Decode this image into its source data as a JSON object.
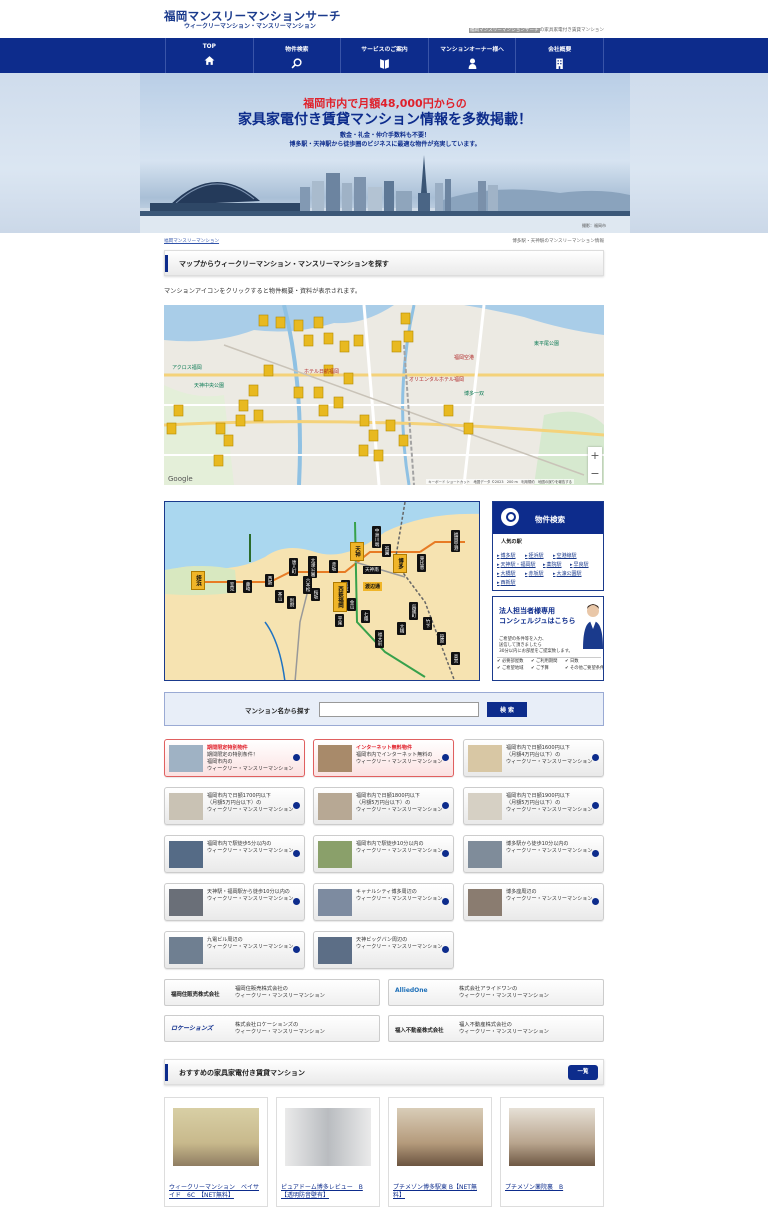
{
  "header": {
    "logo": "福岡マンスリーマンションサーチ",
    "sublogo": "ウィークリーマンション・マンスリーマンション",
    "tagline_hl": "福岡マンスリーマンションサーチ",
    "tagline_rest": "の家具家電付き賃貸マンション"
  },
  "nav": [
    {
      "label": "TOP",
      "icon": "home-icon"
    },
    {
      "label": "物件検索",
      "icon": "search-icon"
    },
    {
      "label": "サービスのご案内",
      "icon": "book-icon"
    },
    {
      "label": "マンションオーナー様へ",
      "icon": "person-icon"
    },
    {
      "label": "会社概要",
      "icon": "building-icon"
    }
  ],
  "hero": {
    "line1": "福岡市内で月額48,000円からの",
    "line2": "家具家電付き賃貸マンション情報を多数掲載！",
    "line3": "敷金・礼金・仲介手数料も不要！",
    "line4": "博多駅・天神駅から徒歩圏のビジネスに最適な物件が充実しています。",
    "caption": "撮影：福岡市"
  },
  "breadcrumb": {
    "left": "福岡マンスリーマンション",
    "right": "博多駅・天神駅のマンスリーマンション情報"
  },
  "map_section": {
    "title": "マップからウィークリーマンション・マンスリーマンションを探す",
    "note": "マンションアイコンをクリックすると物件概要・資料が表示されます。",
    "google": "Google",
    "attribution": "キーボード ショートカット　地図データ ©2023　200 m　利用規約　地図の誤りを報告する",
    "zoom_in": "+",
    "zoom_out": "−"
  },
  "route": {
    "stations": [
      "姪浜",
      "室見",
      "藤崎",
      "西新",
      "唐人町",
      "大濠公園",
      "赤坂",
      "天神",
      "中洲川端",
      "祇園",
      "博多",
      "東比恵",
      "福岡空港",
      "天神南",
      "渡辺通",
      "薬院",
      "桜坂",
      "六本松",
      "別府",
      "茶山",
      "金山",
      "七隈",
      "福大前",
      "呉服町",
      "竹下",
      "笹原",
      "大橋",
      "高宮",
      "平尾",
      "西鉄福岡",
      "天神",
      "福岡"
    ]
  },
  "search_box": {
    "title": "物件検索",
    "popular": "人気の駅",
    "stations": [
      "博多駅",
      "姪浜駅",
      "空港線駅",
      "天神駅・福岡駅",
      "薬院駅",
      "早良駅",
      "大橋駅",
      "赤坂駅",
      "大濠公園駅",
      "西新駅"
    ]
  },
  "concierge": {
    "line1": "法人担当者様専用",
    "line2": "コンシェルジュはこちら",
    "text": "ご希望の条件等を入力、\n送信して頂きましたら\n30分以内にお部屋をご提案致します。",
    "checks": [
      "✔ 必要部屋数",
      "✔ ご利用期間",
      "✔ 日数",
      "✔ ご希望地域",
      "✔ ご予算",
      "✔ その他ご要望条件"
    ]
  },
  "name_search": {
    "label": "マンション名から探す",
    "placeholder": "",
    "button": "検 索"
  },
  "categories": [
    {
      "hl": "期間限定特別物件",
      "text": "期間限定の特別条件！\n福岡市内の\nウィークリー・マンスリーマンション",
      "red": true
    },
    {
      "hl": "インターネット無料物件",
      "text": "福岡市内でインターネット無料の\nウィークリー・マンスリーマンション",
      "red": true
    },
    {
      "hl": "",
      "text": "福岡市内で日額1600円以下\n（月額4万円台以下）の\nウィークリー・マンスリーマンション",
      "red": false
    },
    {
      "hl": "",
      "text": "福岡市内で日額1700円以下\n（月額5万円台以下）の\nウィークリー・マンスリーマンション",
      "red": false
    },
    {
      "hl": "",
      "text": "福岡市内で日額1800円以下\n（月額5万円台以下）の\nウィークリー・マンスリーマンション",
      "red": false
    },
    {
      "hl": "",
      "text": "福岡市内で日額1900円以下\n（月額5万円台以下）の\nウィークリー・マンスリーマンション",
      "red": false
    },
    {
      "hl": "",
      "text": "福岡市内で駅徒歩5分以内の\nウィークリー・マンスリーマンション",
      "red": false
    },
    {
      "hl": "",
      "text": "福岡市内で駅徒歩10分以内の\nウィークリー・マンスリーマンション",
      "red": false
    },
    {
      "hl": "",
      "text": "博多駅から徒歩10分以内の\nウィークリー・マンスリーマンション",
      "red": false
    },
    {
      "hl": "",
      "text": "天神駅・福岡駅から徒歩10分以内の\nウィークリー・マンスリーマンション",
      "red": false
    },
    {
      "hl": "",
      "text": "キャナルシティ博多周辺の\nウィークリー・マンスリーマンション",
      "red": false
    },
    {
      "hl": "",
      "text": "博多座周辺の\nウィークリー・マンスリーマンション",
      "red": false
    },
    {
      "hl": "",
      "text": "九電ビル周辺の\nウィークリー・マンスリーマンション",
      "red": false
    },
    {
      "hl": "",
      "text": "天神ビッグバン周辺の\nウィークリー・マンスリーマンション",
      "red": false
    }
  ],
  "companies": [
    {
      "name": "福岡住販売株式会社",
      "desc": "福岡住販売株式会社の\nウィークリー・マンスリーマンション",
      "logo": ""
    },
    {
      "name": "",
      "desc": "株式会社アライドワンの\nウィークリー・マンスリーマンション",
      "logo": "AlliedOne"
    },
    {
      "name": "",
      "desc": "株式会社ロケーションズの\nウィークリー・マンスリーマンション",
      "logo": "ロケーションズ"
    },
    {
      "name": "福入不動産株式会社",
      "desc": "福入不動産株式会社の\nウィークリー・マンスリーマンション",
      "logo": ""
    }
  ],
  "recommended": {
    "title": "おすすめの家具家電付き賃貸マンション",
    "more": "一覧",
    "items": [
      {
        "name": "ウィークリーマンション　ベイサ\nイド　6C　【NET無料】"
      },
      {
        "name": "ピュアドーム博多レビュー　B\n【透明防音壁有】"
      },
      {
        "name": "プチメゾン博多駅東 B【NET無\n料】"
      },
      {
        "name": "プチメゾン薬院裏　B"
      }
    ]
  },
  "colors": {
    "primary": "#0d2c8c",
    "accent": "#e0202a"
  }
}
